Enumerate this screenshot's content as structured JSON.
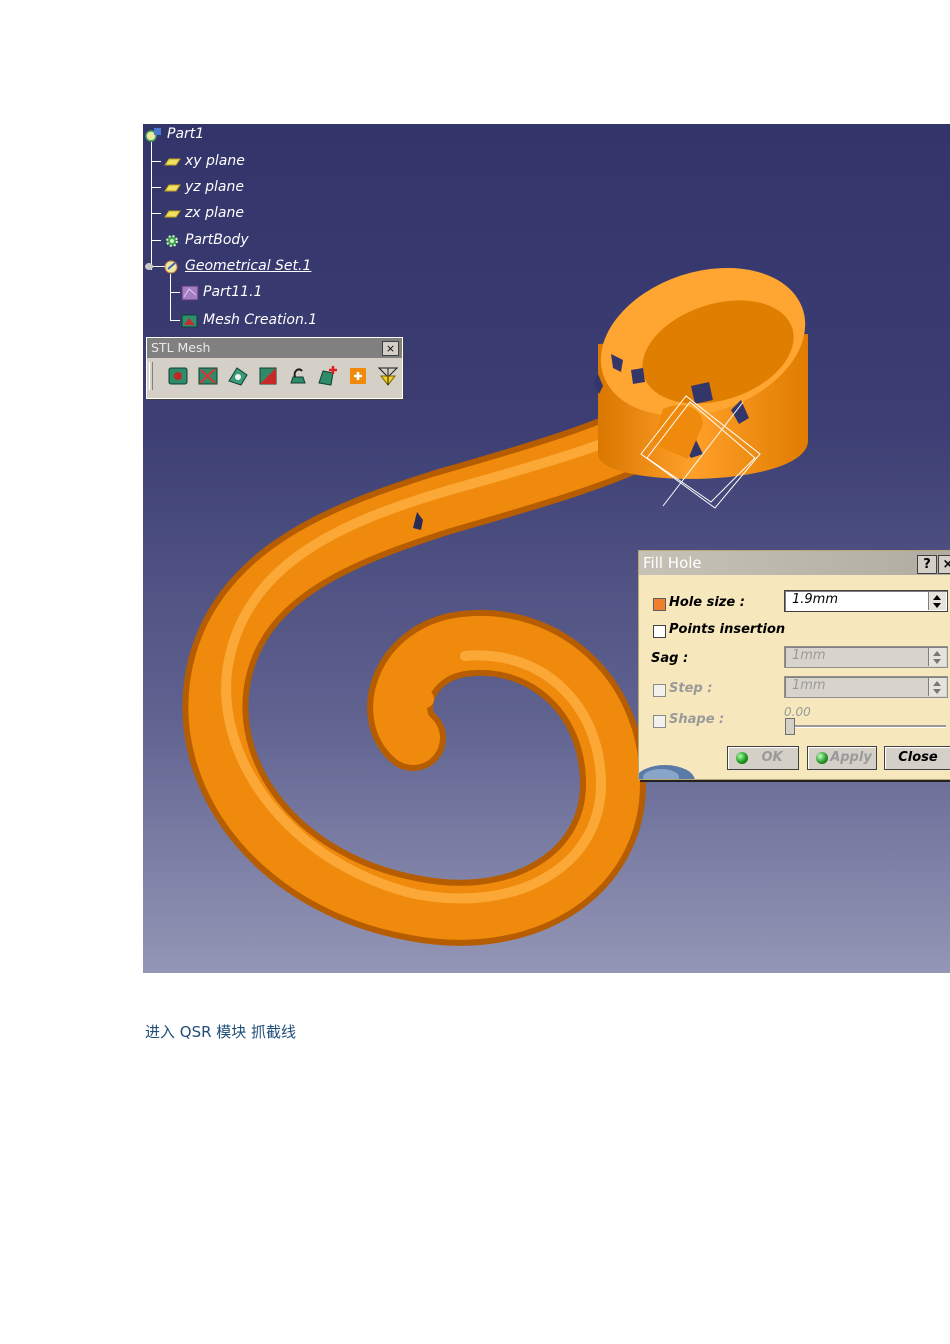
{
  "spec_tree": {
    "root": "Part1",
    "items": [
      {
        "label": "xy plane",
        "icon": "plane-icon"
      },
      {
        "label": "yz plane",
        "icon": "plane-icon"
      },
      {
        "label": "zx plane",
        "icon": "plane-icon"
      },
      {
        "label": "PartBody",
        "icon": "gear-icon"
      },
      {
        "label": "Geometrical Set.1",
        "icon": "geometrical-set-icon"
      }
    ],
    "children": [
      {
        "label": "Part11.1",
        "icon": "cloud-icon"
      },
      {
        "label": "Mesh Creation.1",
        "icon": "mesh-icon"
      }
    ]
  },
  "stl_toolbar": {
    "title": "STL Mesh",
    "close_label": "×",
    "tools": [
      "mesh-cleaner-icon",
      "mesh-smooth-icon",
      "mesh-decimate-icon",
      "mesh-offset-icon",
      "mesh-creation-icon",
      "fill-hole-icon",
      "merge-icon",
      "split-icon"
    ]
  },
  "fill_hole_dialog": {
    "title": "Fill Hole",
    "help_label": "?",
    "close_x_label": "×",
    "hole_size_label": "Hole size :",
    "hole_size_value": "1.9mm",
    "points_insertion_label": "Points insertion",
    "sag_label": "Sag :",
    "sag_value": "1mm",
    "step_label": "Step :",
    "step_value": "1mm",
    "shape_label": "Shape :",
    "shape_value": "0.00",
    "ok_label": "OK",
    "apply_label": "Apply",
    "close_label": "Close"
  },
  "caption": "进入 QSR 模块 抓截线",
  "colors": {
    "background_top": "#33346a",
    "background_bottom": "#9496b6",
    "mesh_orange": "#f08a0c",
    "dialog_bg": "#f6e8bc",
    "caption_text": "#1f4e79"
  }
}
